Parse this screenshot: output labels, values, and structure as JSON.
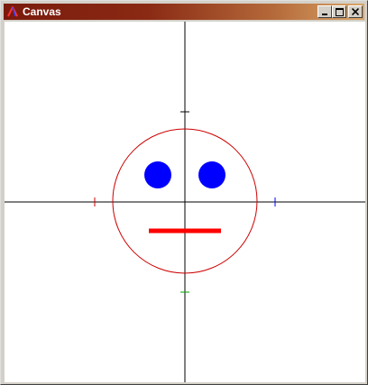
{
  "window": {
    "title": "Canvas",
    "icons": {
      "app": "app-logo-icon",
      "minimize": "minimize-icon",
      "maximize": "maximize-icon",
      "close": "close-icon"
    }
  },
  "canvas": {
    "background": "#ffffff",
    "axis_color": "#000000",
    "face_outline_color": "#cc0000",
    "eye_color": "#0000ff",
    "mouth_color": "#ff0000",
    "tick_colors": {
      "left": "#cc0000",
      "right": "#0000ff",
      "top": "#000000",
      "bottom": "#00aa00"
    }
  }
}
